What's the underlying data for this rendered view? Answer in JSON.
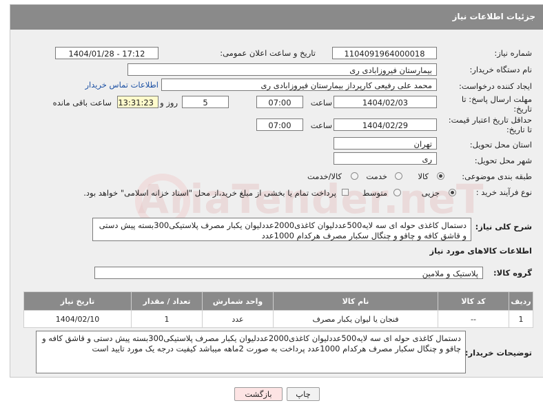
{
  "header": {
    "title": "جزئیات اطلاعات نیاز"
  },
  "form": {
    "need_number_label": "شماره نیاز:",
    "need_number": "1104091964000018",
    "announce_label": "تاریخ و ساعت اعلان عمومی:",
    "announce_value": "1404/01/28 - 17:12",
    "buyer_org_label": "نام دستگاه خریدار:",
    "buyer_org": "بیمارستان فیروزابادی ری",
    "creator_label": "ایجاد کننده درخواست:",
    "creator": "محمد علی رفیعی کارپرداز بیمارستان فیروزابادی ری",
    "contact_link": "اطلاعات تماس خریدار",
    "deadline_label": "مهلت ارسال پاسخ: تا تاریخ:",
    "deadline_date": "1404/02/03",
    "time_label": "ساعت",
    "deadline_time": "07:00",
    "days_value": "5",
    "days_label": "روز و",
    "remaining_time": "13:31:23",
    "remaining_label": "ساعت باقی مانده",
    "validity_label": "حداقل تاریخ اعتبار قیمت: تا تاریخ:",
    "validity_date": "1404/02/29",
    "validity_time": "07:00",
    "province_label": "استان محل تحویل:",
    "province": "تهران",
    "city_label": "شهر محل تحویل:",
    "city": "ری",
    "category_label": "طبقه بندی موضوعی:",
    "category_options": [
      "کالا",
      "خدمت",
      "کالا/خدمت"
    ],
    "category_selected": "کالا",
    "process_label": "نوع فرآیند خرید :",
    "process_options": [
      "جزیی",
      "متوسط"
    ],
    "process_selected": "جزیی",
    "payment_note": "پرداخت تمام یا بخشی از مبلغ خرید،از محل \"اسناد خزانه اسلامی\" خواهد بود."
  },
  "description": {
    "label": "شرح کلی نیاز:",
    "text": "دستمال کاغذی حوله ای سه لایه500عددلیوان کاغذی2000عددلیوان یکبار مصرف پلاستیکی300بسته پیش دستی و قاشق کافه و چاقو و چنگال سکبار مصرف هرکدام 1000عدد"
  },
  "goods": {
    "section_title": "اطلاعات کالاهای مورد نیاز",
    "group_label": "گروه کالا:",
    "group_value": "پلاستیک و ملامین",
    "columns": [
      "ردیف",
      "کد کالا",
      "نام کالا",
      "واحد شمارش",
      "تعداد / مقدار",
      "تاریخ نیاز"
    ],
    "rows": [
      [
        "1",
        "--",
        "فنجان یا لیوان یکبار مصرف",
        "عدد",
        "1",
        "1404/02/10"
      ]
    ]
  },
  "buyer_notes": {
    "label": "توضیحات خریدار:",
    "text": "دستمال کاغذی حوله ای سه لایه500عددلیوان کاغذی2000عددلیوان یکبار مصرف پلاستیکی300بسته پیش دستی و قاشق کافه و چاقو و چنگال سکبار مصرف هرکدام 1000عدد پرداخت به صورت 2ماهه میباشد کیفیت درجه یک مورد تایید است"
  },
  "buttons": {
    "print": "چاپ",
    "back": "بازگشت"
  },
  "watermark": "AriaTender.neT",
  "colors": {
    "header_bg": "#8a8a8a",
    "panel_bg": "#efefef",
    "remaining_bg": "#fffbcc",
    "link": "#1a4fa3"
  }
}
